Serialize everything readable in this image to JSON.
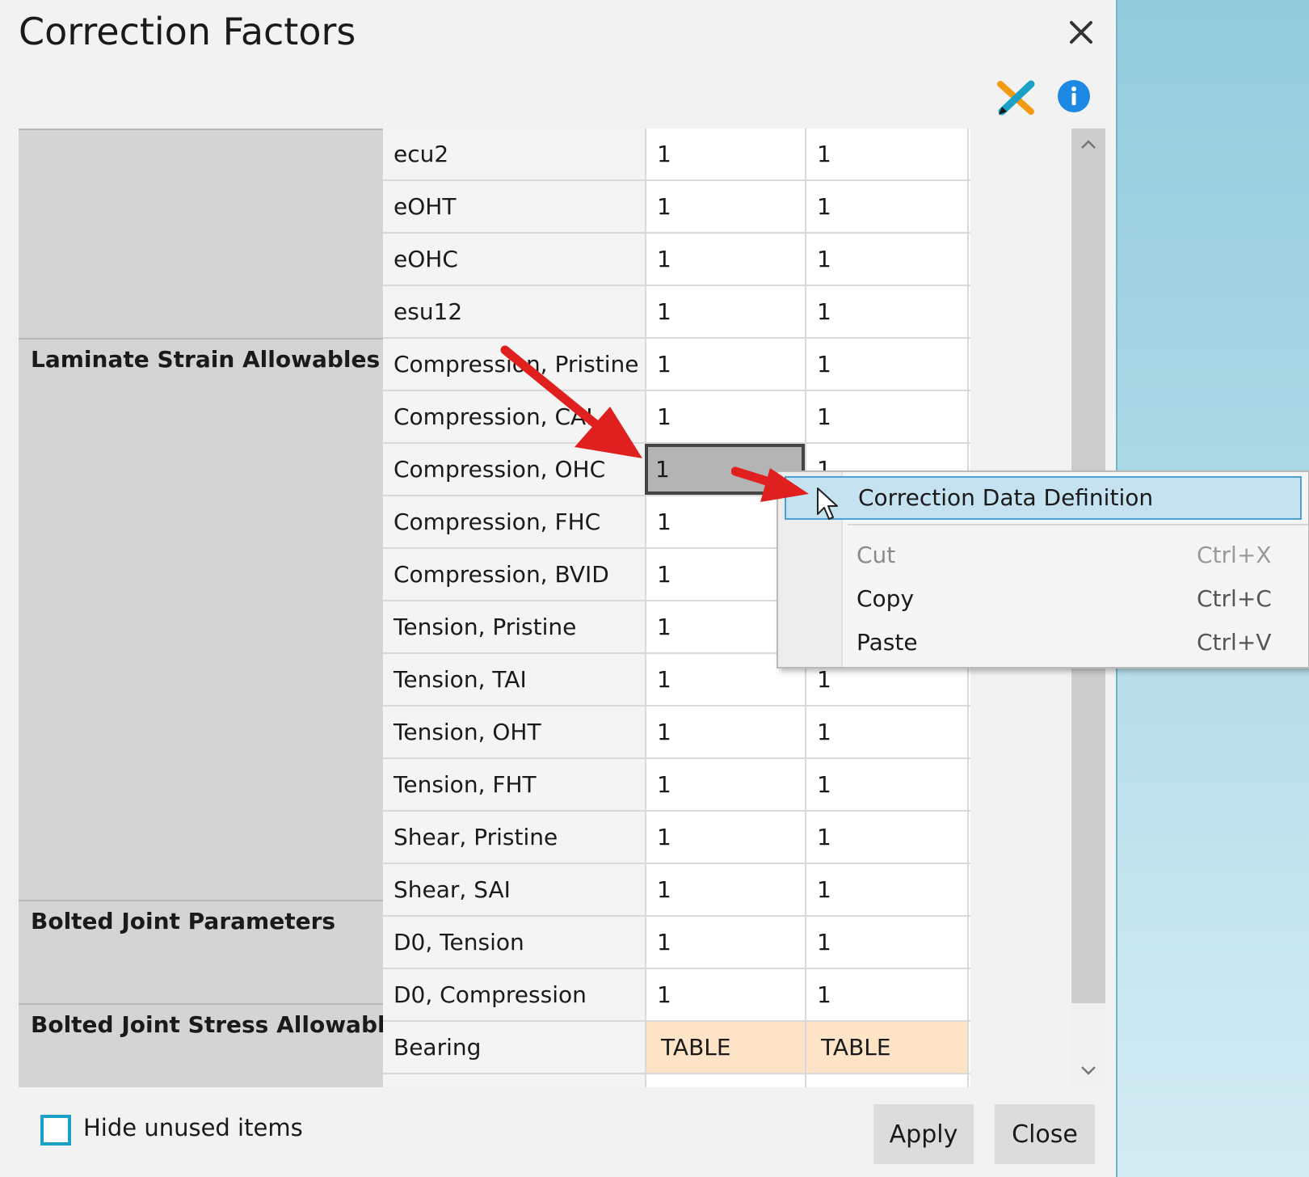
{
  "dialog": {
    "title": "Correction Factors"
  },
  "groups": [
    {
      "label": ""
    },
    {
      "label": "Laminate Strain Allowables"
    },
    {
      "label": "Bolted Joint Parameters"
    },
    {
      "label": "Bolted Joint Stress Allowables"
    }
  ],
  "rows": [
    {
      "name": "ecu2",
      "v1": "1",
      "v2": "1"
    },
    {
      "name": "eOHT",
      "v1": "1",
      "v2": "1"
    },
    {
      "name": "eOHC",
      "v1": "1",
      "v2": "1"
    },
    {
      "name": "esu12",
      "v1": "1",
      "v2": "1"
    },
    {
      "name": "Compression, Pristine",
      "v1": "1",
      "v2": "1"
    },
    {
      "name": "Compression, CAI",
      "v1": "1",
      "v2": "1"
    },
    {
      "name": "Compression, OHC",
      "v1": "1",
      "v2": "1"
    },
    {
      "name": "Compression, FHC",
      "v1": "1",
      "v2": ""
    },
    {
      "name": "Compression, BVID",
      "v1": "1",
      "v2": ""
    },
    {
      "name": "Tension, Pristine",
      "v1": "1",
      "v2": ""
    },
    {
      "name": "Tension, TAI",
      "v1": "1",
      "v2": "1"
    },
    {
      "name": "Tension, OHT",
      "v1": "1",
      "v2": "1"
    },
    {
      "name": "Tension, FHT",
      "v1": "1",
      "v2": "1"
    },
    {
      "name": "Shear, Pristine",
      "v1": "1",
      "v2": "1"
    },
    {
      "name": "Shear, SAI",
      "v1": "1",
      "v2": "1"
    },
    {
      "name": "D0, Tension",
      "v1": "1",
      "v2": "1"
    },
    {
      "name": "D0, Compression",
      "v1": "1",
      "v2": "1"
    },
    {
      "name": "Bearing",
      "v1": "TABLE",
      "v2": "TABLE"
    },
    {
      "name": "",
      "v1": "",
      "v2": ""
    }
  ],
  "context_menu": {
    "items": [
      {
        "label": "Correction Data Definition",
        "shortcut": ""
      },
      {
        "label": "Cut",
        "shortcut": "Ctrl+X"
      },
      {
        "label": "Copy",
        "shortcut": "Ctrl+C"
      },
      {
        "label": "Paste",
        "shortcut": "Ctrl+V"
      }
    ]
  },
  "footer": {
    "hide_unused_label": "Hide unused items",
    "hide_unused_checked": false,
    "apply_label": "Apply",
    "close_label": "Close"
  },
  "colors": {
    "accent": "#1ba1c6",
    "menu_highlight": "#c5e2f0",
    "table_cell": "#fde4c6",
    "arrow": "#e01f1f"
  },
  "icons": [
    "close-icon",
    "tool-pencil-ruler-icon",
    "info-icon",
    "chevron-up-icon",
    "chevron-down-icon",
    "mouse-pointer-icon",
    "red-arrow"
  ]
}
